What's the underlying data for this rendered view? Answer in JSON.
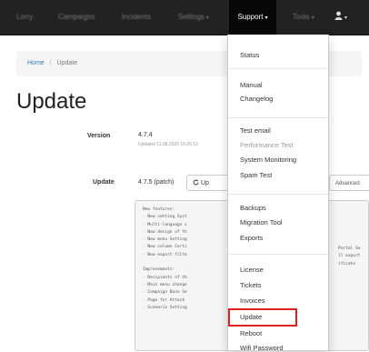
{
  "navbar": {
    "items": [
      "Lorry",
      "Campaigns",
      "Incidents",
      "Settings"
    ],
    "support_label": "Support",
    "tools_label": "Tools",
    "user_icon": "user-icon",
    "caret": "▾"
  },
  "breadcrumb": {
    "home": "Home",
    "separator": "/",
    "current": "Update"
  },
  "page": {
    "title": "Update",
    "version_label": "Version",
    "version_value": "4.7.4",
    "version_updated": "Updated 11.08.2020 16:25:12",
    "update_label": "Update",
    "update_value": "4.7.5 (patch)",
    "update_button": "Up",
    "advanced_button": "Advanced",
    "changelog": "New features:\n- New setting Syst\n- Multi-language s\n- New design of th\n- New menu Setting\n- New column Certi\n- New export filte\n\nImprovements:\n- Recipients of th\n- Main menu change\n- Campaign Base Se\n- Page for Attack\n- Scenario Setting",
    "changelog_right": [
      "Portal Se",
      "ll export",
      "ificate"
    ]
  },
  "dropdown": {
    "items": [
      {
        "label": "Status",
        "disabled": false
      },
      {
        "label": "Manual",
        "disabled": false
      },
      {
        "label": "Changelog",
        "disabled": false
      },
      {
        "label": "Test email",
        "disabled": false
      },
      {
        "label": "Performance Test",
        "disabled": true
      },
      {
        "label": "System Monitoring",
        "disabled": false
      },
      {
        "label": "Spam Test",
        "disabled": false
      },
      {
        "label": "Backups",
        "disabled": false
      },
      {
        "label": "Migration Tool",
        "disabled": false
      },
      {
        "label": "Exports",
        "disabled": false
      },
      {
        "label": "License",
        "disabled": false
      },
      {
        "label": "Tickets",
        "disabled": false
      },
      {
        "label": "Invoices",
        "disabled": false
      },
      {
        "label": "Update",
        "disabled": false
      },
      {
        "label": "Reboot",
        "disabled": false
      },
      {
        "label": "Wifi Password",
        "disabled": false
      }
    ],
    "highlighted": "Update",
    "highlight_color": "#e02020"
  }
}
